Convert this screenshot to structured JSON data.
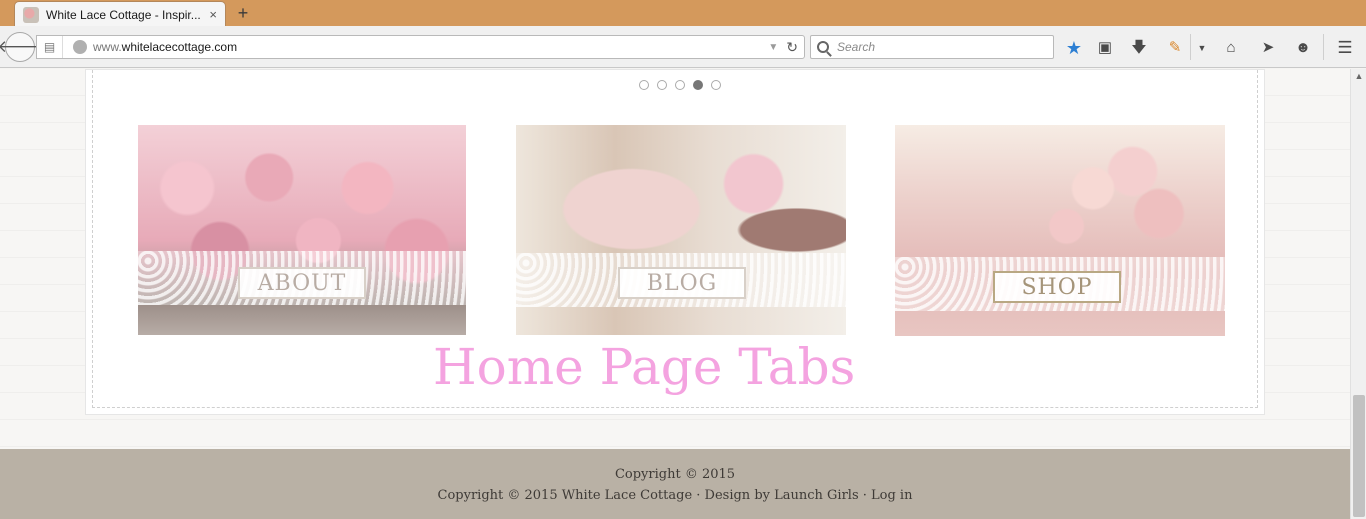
{
  "browser": {
    "tab_title": "White Lace Cottage - Inspir...",
    "tab_close": "×",
    "new_tab": "+",
    "url_prefix": "www.",
    "url_domain": "whitelacecottage.com",
    "search_placeholder": "Search"
  },
  "slider": {
    "dot_count": 5,
    "active_index": 3
  },
  "tiles": [
    {
      "label": "ABOUT"
    },
    {
      "label": "BLOG"
    },
    {
      "label": "SHOP"
    }
  ],
  "watermark": "Home Page Tabs",
  "footer": {
    "line1": "Copyright © 2015",
    "line2": "Copyright © 2015 White Lace Cottage · Design by Launch Girls · Log in"
  },
  "colors": {
    "tabstrip": "#d4995c",
    "watermark": "#f4a3e0",
    "footer": "#b9b1a5",
    "bookmark_star": "#2d7fd3"
  }
}
